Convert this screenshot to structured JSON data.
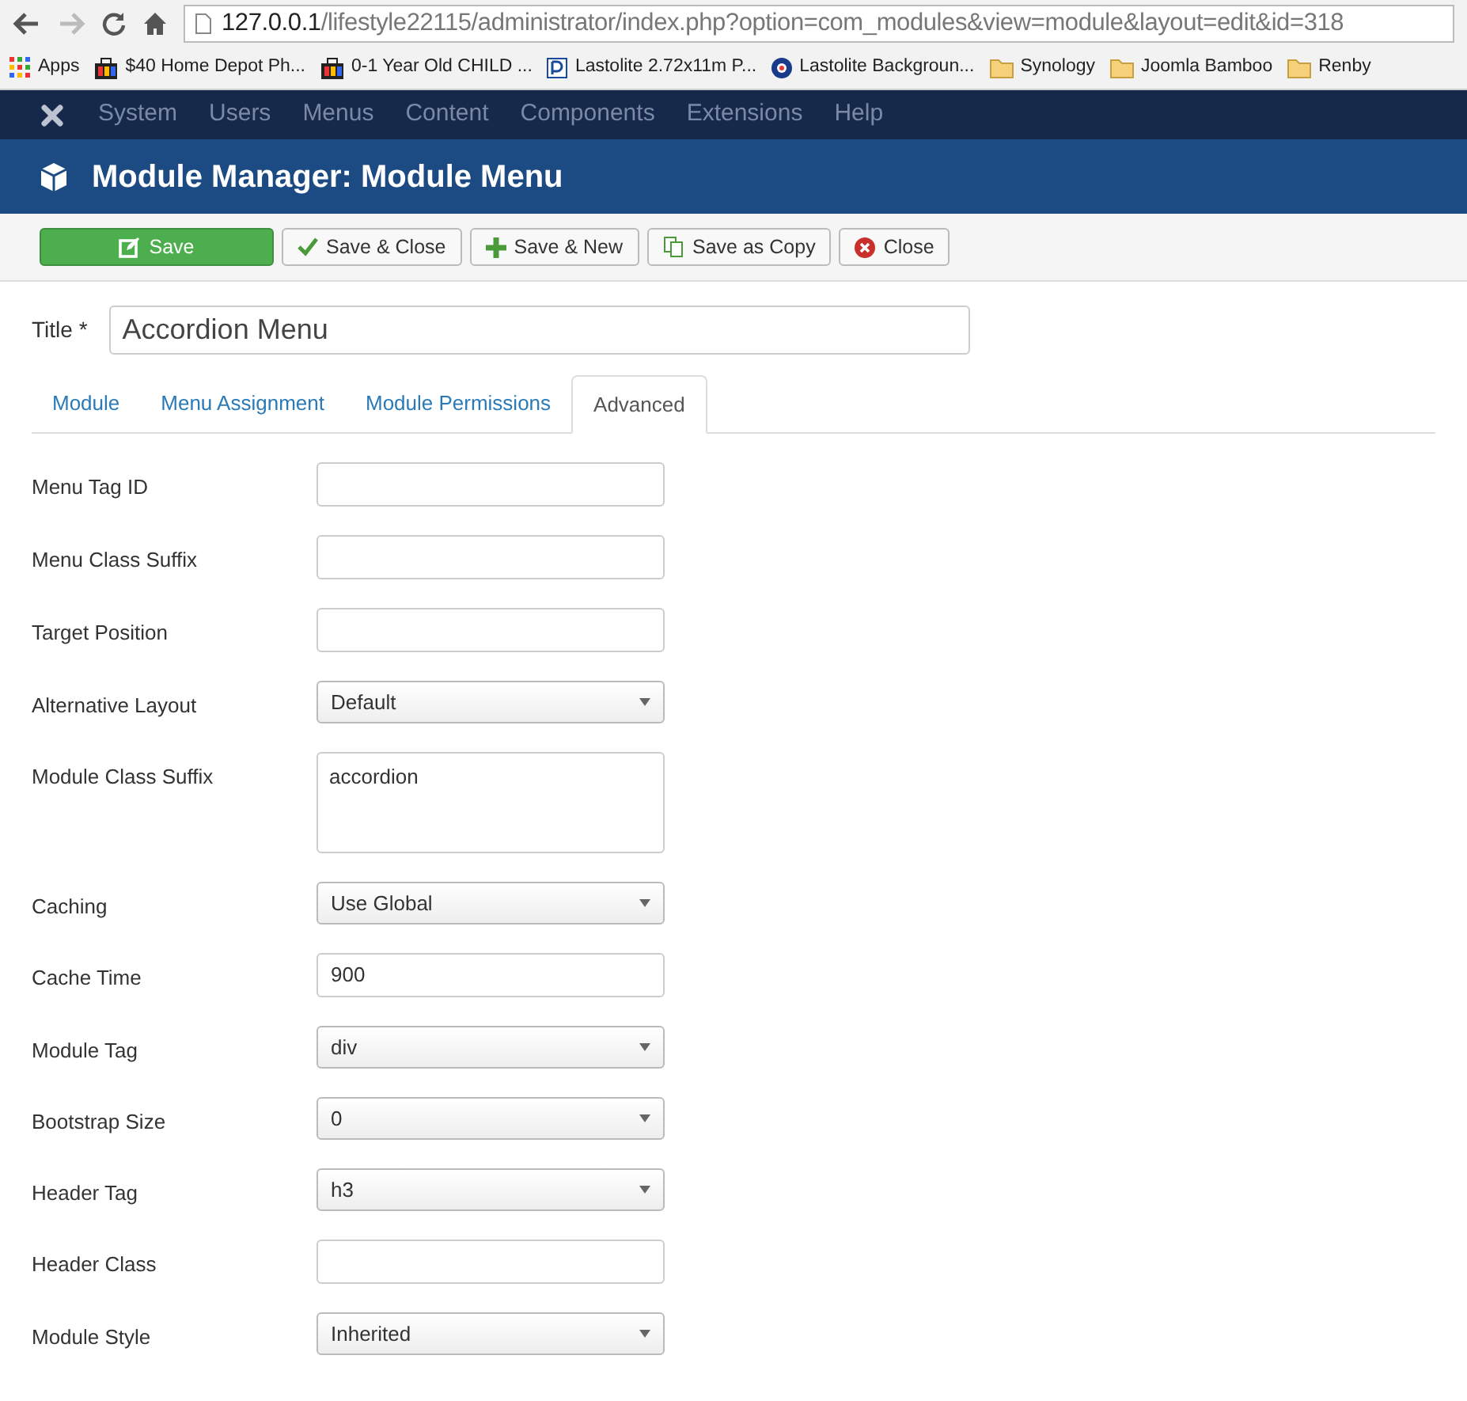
{
  "browser": {
    "url_host": "127.0.0.1",
    "url_path": "/lifestyle22115/administrator/index.php?option=com_modules&view=module&layout=edit&id=318",
    "bookmarks": [
      {
        "label": "Apps",
        "kind": "apps"
      },
      {
        "label": "$40 Home Depot Ph...",
        "kind": "shop"
      },
      {
        "label": "0-1 Year Old CHILD ...",
        "kind": "shop"
      },
      {
        "label": "Lastolite 2.72x11m P...",
        "kind": "doc"
      },
      {
        "label": "Lastolite Backgroun...",
        "kind": "globe"
      },
      {
        "label": "Synology",
        "kind": "folder"
      },
      {
        "label": "Joomla Bamboo",
        "kind": "folder"
      },
      {
        "label": "Renby",
        "kind": "folder"
      }
    ]
  },
  "menu": [
    "System",
    "Users",
    "Menus",
    "Content",
    "Components",
    "Extensions",
    "Help"
  ],
  "page_title": "Module Manager: Module Menu",
  "toolbar": [
    {
      "label": "Save",
      "kind": "save"
    },
    {
      "label": "Save & Close",
      "kind": "check"
    },
    {
      "label": "Save & New",
      "kind": "plus"
    },
    {
      "label": "Save as Copy",
      "kind": "copy"
    },
    {
      "label": "Close",
      "kind": "close"
    }
  ],
  "title_field": {
    "label": "Title *",
    "value": "Accordion Menu"
  },
  "tabs": [
    {
      "label": "Module",
      "selected": false
    },
    {
      "label": "Menu Assignment",
      "selected": false
    },
    {
      "label": "Module Permissions",
      "selected": false
    },
    {
      "label": "Advanced",
      "selected": true
    }
  ],
  "fields": [
    {
      "label": "Menu Tag ID",
      "kind": "text"
    },
    {
      "label": "Menu Class Suffix",
      "kind": "text"
    },
    {
      "label": "Target Position",
      "kind": "text"
    },
    {
      "label": "Alternative Layout",
      "kind": "select",
      "value": "Default"
    },
    {
      "label": "Module Class Suffix",
      "kind": "textarea",
      "value": "accordion"
    },
    {
      "label": "Caching",
      "kind": "select",
      "value": "Use Global"
    },
    {
      "label": "Cache Time",
      "kind": "text",
      "value": "900"
    },
    {
      "label": "Module Tag",
      "kind": "select",
      "value": "div"
    },
    {
      "label": "Bootstrap Size",
      "kind": "select",
      "value": "0"
    },
    {
      "label": "Header Tag",
      "kind": "select",
      "value": "h3"
    },
    {
      "label": "Header Class",
      "kind": "text"
    },
    {
      "label": "Module Style",
      "kind": "select",
      "value": "Inherited"
    }
  ]
}
